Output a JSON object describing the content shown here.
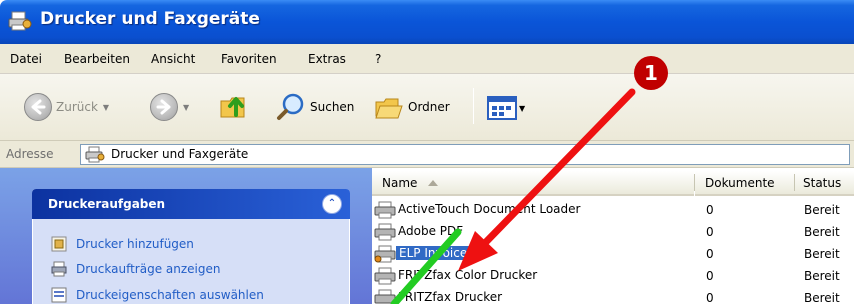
{
  "window": {
    "title": "Drucker und Faxgeräte",
    "title_icon": "printers-faxes-icon"
  },
  "menu": {
    "items": [
      "Datei",
      "Bearbeiten",
      "Ansicht",
      "Favoriten",
      "Extras",
      "?"
    ]
  },
  "toolbar": {
    "back_label": "Zurück",
    "search_label": "Suchen",
    "folders_label": "Ordner",
    "icons": [
      "back-arrow-icon",
      "forward-arrow-icon",
      "folder-up-icon",
      "search-icon",
      "folders-icon",
      "views-icon"
    ]
  },
  "address": {
    "label": "Adresse",
    "value": "Drucker und Faxgeräte"
  },
  "task_pane": {
    "title": "Druckeraufgaben",
    "collapse_glyph": "⌃",
    "items": [
      {
        "label": "Drucker hinzufügen",
        "icon": "add-printer-icon"
      },
      {
        "label": "Druckaufträge anzeigen",
        "icon": "print-jobs-icon"
      },
      {
        "label": "Druckeigenschaften auswählen",
        "icon": "printer-properties-icon"
      }
    ]
  },
  "file_list": {
    "columns": [
      "Name",
      "Dokumente",
      "Status"
    ],
    "rows": [
      {
        "name": "ActiveTouch Document Loader",
        "documents": "0",
        "status": "Bereit",
        "selected": false
      },
      {
        "name": "Adobe PDF",
        "documents": "0",
        "status": "Bereit",
        "selected": false
      },
      {
        "name": "ELP Invoice",
        "documents": "0",
        "status": "Bereit",
        "selected": true
      },
      {
        "name": "FRITZfax Color Drucker",
        "documents": "0",
        "status": "Bereit",
        "selected": false
      },
      {
        "name": "FRITZfax Drucker",
        "documents": "0",
        "status": "Bereit",
        "selected": false
      }
    ]
  },
  "annotation": {
    "marker_text": "1",
    "arrow_red_color": "#ee1111",
    "arrow_green_color": "#22cc22",
    "marker_color": "#c00000"
  },
  "colors": {
    "titlebar": "#0a55d8",
    "selection": "#316ac5",
    "task_link": "#215dc6"
  }
}
